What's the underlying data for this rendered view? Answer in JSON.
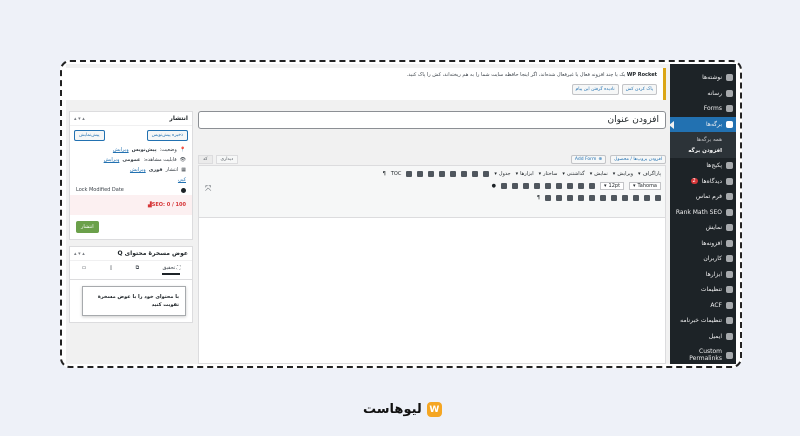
{
  "sidebar": {
    "items": [
      {
        "label": "نوشته‌ها",
        "icon": "pin-icon"
      },
      {
        "label": "رسانه",
        "icon": "media-icon"
      },
      {
        "label": "Forms",
        "icon": "forms-icon"
      },
      {
        "label": "برگه‌ها",
        "icon": "pages-icon",
        "active": true
      }
    ],
    "submenu": [
      "همه برگه‌ها",
      "افزودن برگه"
    ],
    "items2": [
      {
        "label": "پکیج‌ها",
        "icon": "package-icon"
      },
      {
        "label": "دیدگاه‌ها",
        "icon": "comments-icon",
        "badge": "2"
      },
      {
        "label": "فرم تماس",
        "icon": "mail-icon"
      },
      {
        "label": "Rank Math SEO",
        "icon": "rankmath-icon"
      },
      {
        "label": "نمایش",
        "icon": "appearance-icon"
      },
      {
        "label": "افزونه‌ها",
        "icon": "plugins-icon"
      },
      {
        "label": "کاربران",
        "icon": "users-icon"
      },
      {
        "label": "ابزارها",
        "icon": "tools-icon"
      },
      {
        "label": "تنظیمات",
        "icon": "settings-icon"
      },
      {
        "label": "ACF",
        "icon": "acf-icon"
      },
      {
        "label": "تنظیمات خبرنامه",
        "icon": "newsletter-icon"
      },
      {
        "label": "ایمیل",
        "icon": "email-icon"
      },
      {
        "label": "Custom Permalinks",
        "icon": "permalink-icon"
      }
    ]
  },
  "notice": {
    "brand": "WP Rocket",
    "text": "یک یا چند افزونه فعال یا غیرفعال شده‌اند، اگر اینجا حافظه سایت شما را به هم ریخته‌اند، کش را پاک کنید.",
    "btn_clear": "پاک کردن کش",
    "btn_dismiss": "نادیده گرفتن این پیام"
  },
  "editor": {
    "title_placeholder": "افزودن عنوان",
    "btn_add_product": "افزودن پروپ‌ها / محصول",
    "btn_add_form": "Add Form",
    "tab_visual": "دیداری",
    "tab_code": "کد",
    "toolbar_row1": {
      "paragraph": "پاراگراف",
      "font": "ویرایش",
      "format": "نمایش",
      "insert": "گذاشتنی",
      "fullscreen": "ساختار",
      "tools": "ابزارها",
      "table": "جدول",
      "toc": "TOC"
    },
    "toolbar_row2": {
      "font_family": "Tahoma",
      "font_size": "12pt"
    }
  },
  "publish": {
    "title": "انتشار",
    "btn_save_draft": "ذخیره پیش‌نویس",
    "btn_preview": "پیش‌نمایش",
    "status_label": "وضعیت:",
    "status_value": "پیش‌نویس",
    "visibility_label": "قابلیت مشاهده:",
    "visibility_value": "عمومی",
    "schedule_label": "انتشار",
    "schedule_value": "فوری",
    "edit_link": "ویرایش",
    "lock_label": "Lock Modified Date",
    "copy_link": "کپی",
    "seo_text": "SEO: 0 / 100",
    "btn_publish": "انتشار"
  },
  "ai_box": {
    "title": "عوض مسخرهٔ محتوای Q",
    "tab_analyze": "تحقیق",
    "card_text": "با محتوای خود را با عوض مسخرهٔ تقویت کنید"
  },
  "brand": {
    "logo_text": "لیوهاست"
  },
  "colors": {
    "admin_bar": "#1d2327",
    "accent": "#2271b1",
    "publish": "#6ba04a",
    "notice_border": "#dba617",
    "logo": "#f5a623"
  }
}
